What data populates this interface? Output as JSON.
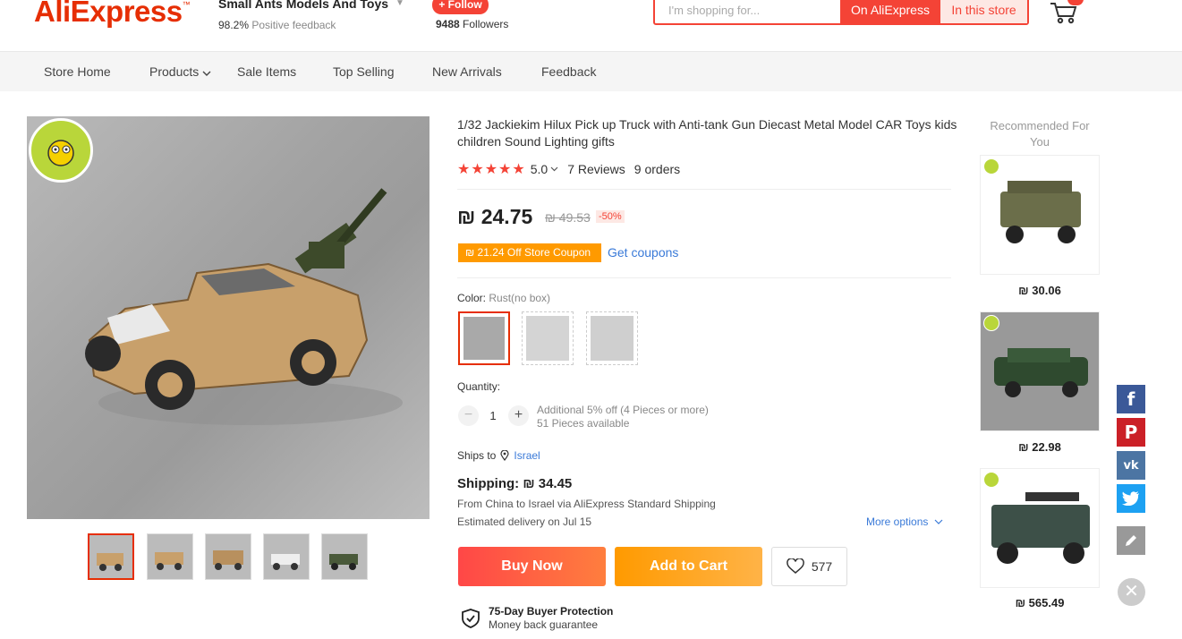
{
  "header": {
    "logo_text": "AliExpress",
    "store_name": "Small Ants Models And Toys",
    "feedback_percent": "98.2%",
    "feedback_label": "Positive feedback",
    "follow_label": "+ Follow",
    "followers_count": "9488",
    "followers_label": "Followers",
    "search_placeholder": "I'm shopping for...",
    "search_on_aliexpress": "On AliExpress",
    "search_in_store": "In this store"
  },
  "nav": {
    "items": [
      "Store Home",
      "Products",
      "Sale Items",
      "Top Selling",
      "New Arrivals",
      "Feedback"
    ]
  },
  "product": {
    "title": "1/32 Jackiekim Hilux Pick up Truck with Anti-tank Gun Diecast Metal Model CAR Toys kids children Sound Lighting gifts",
    "rating": "5.0",
    "reviews": "7 Reviews",
    "orders": "9 orders",
    "price": "₪ 24.75",
    "original_price": "₪ 49.53",
    "discount": "-50%",
    "coupon": "₪ 21.24 Off Store Coupon",
    "get_coupons": "Get coupons",
    "color_label": "Color:",
    "color_value": "Rust(no box)",
    "quantity_label": "Quantity:",
    "quantity": "1",
    "qty_note1": "Additional 5% off (4 Pieces or more)",
    "qty_note2": "51 Pieces available",
    "ships_to_label": "Ships to",
    "ships_to_country": "Israel",
    "shipping_cost": "Shipping: ₪ 34.45",
    "ship_from": "From China to Israel via AliExpress Standard Shipping",
    "delivery": "Estimated delivery on Jul 15",
    "more_options": "More options",
    "buy_now": "Buy Now",
    "add_to_cart": "Add to Cart",
    "wishlist_count": "577",
    "protection_title": "75-Day Buyer Protection",
    "protection_sub": "Money back guarantee"
  },
  "recommendations": {
    "title": "Recommended For You",
    "items": [
      {
        "price": "₪ 30.06"
      },
      {
        "price": "₪ 22.98"
      },
      {
        "price": "₪ 565.49"
      }
    ]
  },
  "social": {
    "icons": [
      "facebook-icon",
      "pinterest-icon",
      "vk-icon",
      "twitter-icon",
      "edit-icon",
      "close-icon"
    ]
  }
}
